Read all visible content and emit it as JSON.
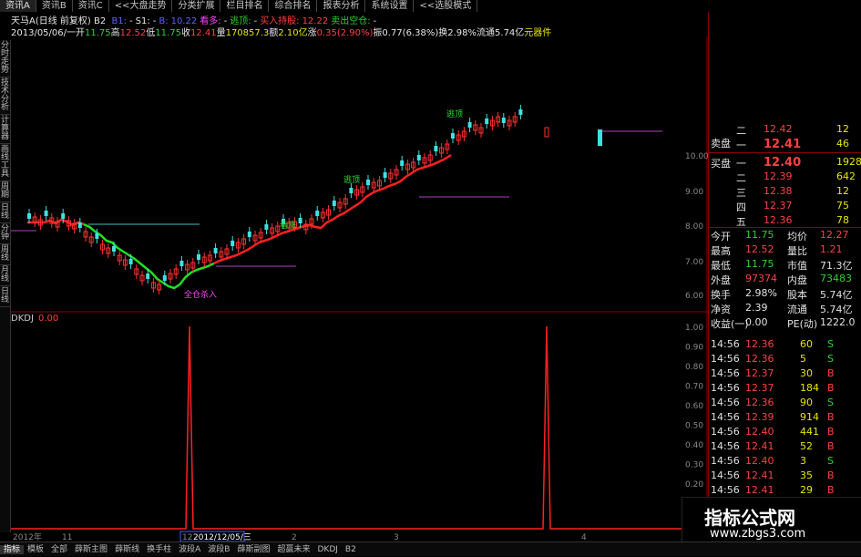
{
  "tabs": [
    "资讯A",
    "资讯B",
    "资讯C",
    "<<大盘走势",
    "分类扩展",
    "栏目排名",
    "综合排名",
    "报表分析",
    "系统设置",
    "<<选股模式"
  ],
  "active_tab": 0,
  "left_tabs": [
    "分时走势",
    "技术分析",
    "计算器",
    "画线工具",
    "周期",
    "日线",
    "分钟",
    "周线",
    "月线",
    "日线"
  ],
  "header": {
    "stock": "天马A(日线 前复权)",
    "formula": "B2",
    "items": [
      {
        "t": "B1:",
        "c": "b"
      },
      {
        "t": "-",
        "c": "w"
      },
      {
        "t": "S1:",
        "c": "w"
      },
      {
        "t": "-",
        "c": "w"
      },
      {
        "t": "B:",
        "c": "b"
      },
      {
        "t": "10.22",
        "c": "b"
      },
      {
        "t": "看多:",
        "c": "m"
      },
      {
        "t": "-",
        "c": "w"
      },
      {
        "t": "逃顶:",
        "c": "g"
      },
      {
        "t": "-",
        "c": "w"
      },
      {
        "t": "买入持股:",
        "c": "r"
      },
      {
        "t": "12.22",
        "c": "r"
      },
      {
        "t": "卖出空仓:",
        "c": "g"
      },
      {
        "t": "-",
        "c": "w"
      }
    ],
    "line2": [
      {
        "t": "2013/05/06/一",
        "c": "w"
      },
      {
        "t": "开",
        "c": "w"
      },
      {
        "t": "11.75",
        "c": "g"
      },
      {
        "t": "高",
        "c": "w"
      },
      {
        "t": "12.52",
        "c": "r"
      },
      {
        "t": "低",
        "c": "w"
      },
      {
        "t": "11.75",
        "c": "g"
      },
      {
        "t": "收",
        "c": "w"
      },
      {
        "t": "12.41",
        "c": "r"
      },
      {
        "t": "量",
        "c": "w"
      },
      {
        "t": "170857.3",
        "c": "y"
      },
      {
        "t": "额",
        "c": "w"
      },
      {
        "t": "2.10亿",
        "c": "y"
      },
      {
        "t": "涨",
        "c": "w"
      },
      {
        "t": "0.35(2.90%)",
        "c": "r"
      },
      {
        "t": "振",
        "c": "w"
      },
      {
        "t": "0.77(6.38%)",
        "c": "w"
      },
      {
        "t": "换",
        "c": "w"
      },
      {
        "t": "2.98%",
        "c": "w"
      },
      {
        "t": "流通",
        "c": "w"
      },
      {
        "t": "5.74亿",
        "c": "w"
      },
      {
        "t": "元器件",
        "c": "y"
      }
    ]
  },
  "price_axis": [
    "10.00",
    "9.00",
    "8.00",
    "7.00",
    "6.00"
  ],
  "indicator": {
    "name": "DKDJ",
    "value": "0.00",
    "axis": [
      "1.00",
      "0.90",
      "0.80",
      "0.70",
      "0.60",
      "0.50",
      "0.40",
      "0.30",
      "0.20",
      "0.10"
    ]
  },
  "signal_labels": [
    {
      "t": "全仓杀入",
      "c": "m"
    },
    {
      "t": "看涨",
      "c": "g"
    },
    {
      "t": "逃顶",
      "c": "g"
    },
    {
      "t": "逃顶",
      "c": "g"
    }
  ],
  "time_axis": [
    "2012年",
    "11",
    "12",
    "2012/12/05/三",
    "2",
    "3",
    "4",
    "5"
  ],
  "orderbook": {
    "sell_label": "卖盘",
    "buy_label": "买盘",
    "sell": [
      {
        "lvl": "二",
        "p": "12.42",
        "v": "12"
      },
      {
        "lvl": "一",
        "p": "12.41",
        "v": "46"
      }
    ],
    "buy": [
      {
        "lvl": "一",
        "p": "12.40",
        "v": "1928"
      },
      {
        "lvl": "二",
        "p": "12.39",
        "v": "642"
      },
      {
        "lvl": "三",
        "p": "12.38",
        "v": "12"
      },
      {
        "lvl": "四",
        "p": "12.37",
        "v": "75"
      },
      {
        "lvl": "五",
        "p": "12.36",
        "v": "78"
      }
    ]
  },
  "stats": [
    {
      "l1": "今开",
      "v1": "11.75",
      "c1": "g",
      "l2": "均价",
      "v2": "12.27",
      "c2": "r"
    },
    {
      "l1": "最高",
      "v1": "12.52",
      "c1": "r",
      "l2": "量比",
      "v2": "1.21",
      "c2": "r"
    },
    {
      "l1": "最低",
      "v1": "11.75",
      "c1": "g",
      "l2": "市值",
      "v2": "71.3亿",
      "c2": "w"
    },
    {
      "l1": "外盘",
      "v1": "97374",
      "c1": "r",
      "l2": "内盘",
      "v2": "73483",
      "c2": "g"
    },
    {
      "l1": "换手",
      "v1": "2.98%",
      "c1": "w",
      "l2": "股本",
      "v2": "5.74亿",
      "c2": "w"
    },
    {
      "l1": "净资",
      "v1": "2.39",
      "c1": "w",
      "l2": "流通",
      "v2": "5.74亿",
      "c2": "w"
    },
    {
      "l1": "收益(一)",
      "v1": "0.00",
      "c1": "w",
      "l2": "PE(动)",
      "v2": "1222.0",
      "c2": "w"
    }
  ],
  "ticks": [
    {
      "t": "14:56",
      "p": "12.36",
      "v": "60",
      "d": "S"
    },
    {
      "t": "14:56",
      "p": "12.36",
      "v": "5",
      "d": "S"
    },
    {
      "t": "14:56",
      "p": "12.37",
      "v": "30",
      "d": "B"
    },
    {
      "t": "14:56",
      "p": "12.37",
      "v": "184",
      "d": "B"
    },
    {
      "t": "14:56",
      "p": "12.36",
      "v": "90",
      "d": "S"
    },
    {
      "t": "14:56",
      "p": "12.39",
      "v": "914",
      "d": "B"
    },
    {
      "t": "14:56",
      "p": "12.40",
      "v": "441",
      "d": "B"
    },
    {
      "t": "14:56",
      "p": "12.41",
      "v": "52",
      "d": "B"
    },
    {
      "t": "14:56",
      "p": "12.40",
      "v": "3",
      "d": "S"
    },
    {
      "t": "14:56",
      "p": "12.41",
      "v": "35",
      "d": "B"
    },
    {
      "t": "14:56",
      "p": "12.41",
      "v": "29",
      "d": "B"
    }
  ],
  "bottom_tabs": [
    "指标",
    "模板",
    "全部",
    "薛斯主图",
    "薛斯线",
    "换手柱",
    "波段A",
    "波段B",
    "薛斯副图",
    "超赢未来",
    "DKDJ",
    "B2"
  ],
  "bottom_selected": 0,
  "watermark": {
    "line1": "指标公式网",
    "line2": "www.zbgs3.com"
  },
  "colors": {
    "up": "#ff3030",
    "down": "#40e0e0",
    "ma_up": "#ff2020",
    "ma_down": "#20e020",
    "accent_border": "#8b0000"
  }
}
